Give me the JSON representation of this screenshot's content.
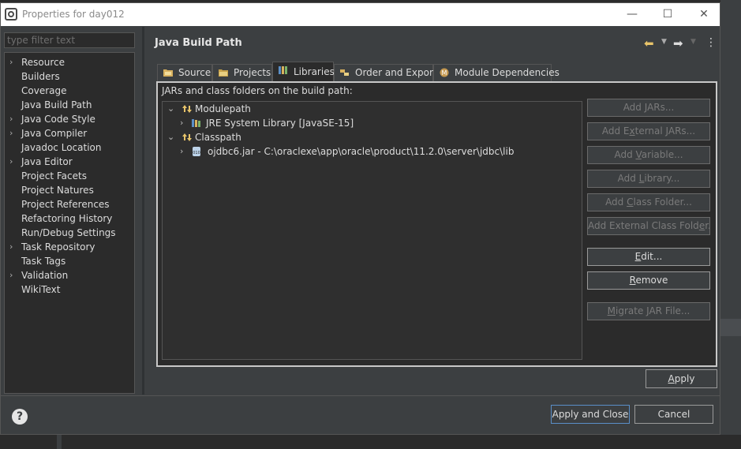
{
  "window": {
    "title": "Properties for day012",
    "minimize_glyph": "—",
    "maximize_glyph": "☐",
    "close_glyph": "✕"
  },
  "filter": {
    "placeholder": "type filter text"
  },
  "nav": {
    "items": [
      {
        "label": "Resource",
        "expandable": true
      },
      {
        "label": "Builders",
        "expandable": false
      },
      {
        "label": "Coverage",
        "expandable": false
      },
      {
        "label": "Java Build Path",
        "expandable": false,
        "selected": true
      },
      {
        "label": "Java Code Style",
        "expandable": true
      },
      {
        "label": "Java Compiler",
        "expandable": true
      },
      {
        "label": "Javadoc Location",
        "expandable": false
      },
      {
        "label": "Java Editor",
        "expandable": true
      },
      {
        "label": "Project Facets",
        "expandable": false
      },
      {
        "label": "Project Natures",
        "expandable": false
      },
      {
        "label": "Project References",
        "expandable": false
      },
      {
        "label": "Refactoring History",
        "expandable": false
      },
      {
        "label": "Run/Debug Settings",
        "expandable": false
      },
      {
        "label": "Task Repository",
        "expandable": true
      },
      {
        "label": "Task Tags",
        "expandable": false
      },
      {
        "label": "Validation",
        "expandable": true
      },
      {
        "label": "WikiText",
        "expandable": false
      }
    ]
  },
  "panel": {
    "title": "Java Build Path",
    "back_icon": "arrow-left-icon",
    "forward_icon": "arrow-right-icon",
    "menu_glyph": "⋮"
  },
  "tabs": [
    {
      "label": "Source",
      "icon": "source-folder-icon"
    },
    {
      "label": "Projects",
      "icon": "projects-icon"
    },
    {
      "label": "Libraries",
      "icon": "libraries-icon",
      "active": true
    },
    {
      "label": "Order and Export",
      "icon": "order-export-icon"
    },
    {
      "label": "Module Dependencies",
      "icon": "module-icon"
    }
  ],
  "libraries": {
    "heading": "JARs and class folders on the build path:",
    "tree": [
      {
        "label": "Modulepath",
        "expanded": true,
        "icon": "modulepath-icon"
      },
      {
        "label": "JRE System Library [JavaSE-15]",
        "expanded": false,
        "icon": "jre-library-icon"
      },
      {
        "label": "Classpath",
        "expanded": true,
        "icon": "classpath-icon"
      },
      {
        "label": "ojdbc6.jar - C:\\oraclexe\\app\\oracle\\product\\11.2.0\\server\\jdbc\\lib",
        "expanded": false,
        "icon": "jar-icon"
      }
    ]
  },
  "side_buttons": [
    {
      "pre": "Add ",
      "u": "J",
      "post": "ARs...",
      "enabled": false
    },
    {
      "pre": "Add E",
      "u": "x",
      "post": "ternal JARs...",
      "enabled": false
    },
    {
      "pre": "Add ",
      "u": "V",
      "post": "ariable...",
      "enabled": false
    },
    {
      "pre": "Add ",
      "u": "L",
      "post": "ibrary...",
      "enabled": false
    },
    {
      "pre": "Add ",
      "u": "C",
      "post": "lass Folder...",
      "enabled": false
    },
    {
      "pre": "Add External Class Fold",
      "u": "e",
      "post": "r...",
      "enabled": false
    },
    {
      "pre": "",
      "u": "E",
      "post": "dit...",
      "enabled": true
    },
    {
      "pre": "",
      "u": "R",
      "post": "emove",
      "enabled": true
    },
    {
      "pre": "",
      "u": "M",
      "post": "igrate JAR File...",
      "enabled": false
    }
  ],
  "apply": {
    "pre": "",
    "u": "A",
    "post": "pply"
  },
  "footer": {
    "help_glyph": "?",
    "apply_close": "Apply and Close",
    "cancel": "Cancel"
  }
}
